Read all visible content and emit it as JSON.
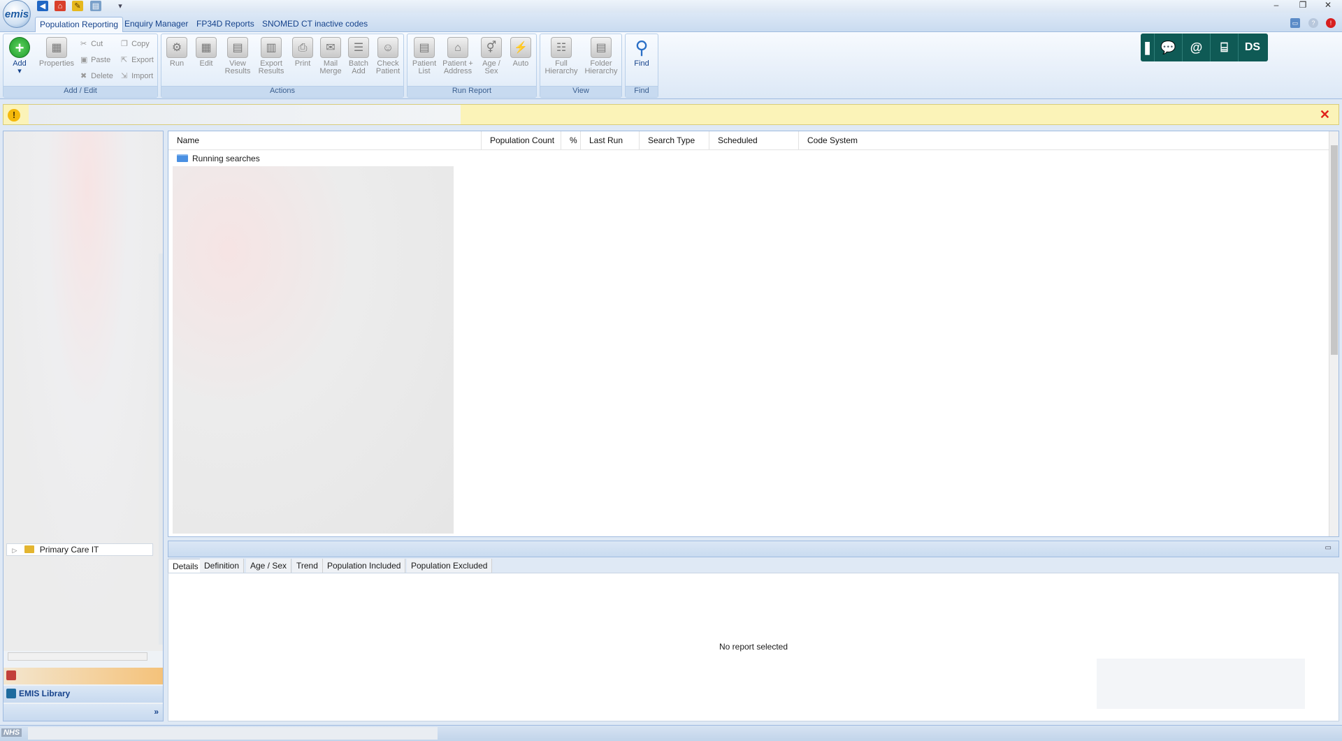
{
  "app": {
    "logo_text": "emis"
  },
  "window": {
    "minimize": "–",
    "restore": "❐",
    "close": "✕"
  },
  "ribbon_tabs": [
    {
      "label": "Population Reporting",
      "active": true
    },
    {
      "label": "Enquiry Manager",
      "active": false
    },
    {
      "label": "FP34D Reports",
      "active": false
    },
    {
      "label": "SNOMED CT inactive codes",
      "active": false
    }
  ],
  "ribbon": {
    "groups": {
      "add_edit": "Add / Edit",
      "actions": "Actions",
      "run_report": "Run Report",
      "view": "View",
      "find": "Find"
    },
    "add": {
      "label": "Add",
      "arrow": "▾"
    },
    "properties": "Properties",
    "cut": "Cut",
    "paste": "Paste",
    "delete": "Delete",
    "copy": "Copy",
    "export": "Export",
    "import": "Import",
    "run": "Run",
    "edit": "Edit",
    "view_results": "View Results",
    "export_results": "Export Results",
    "print": "Print",
    "mail_merge": "Mail Merge",
    "batch_add": "Batch Add",
    "check_patient": "Check Patient",
    "patient_list": "Patient List",
    "patient_address": "Patient + Address",
    "age_sex": "Age / Sex",
    "auto": "Auto",
    "full_hierarchy": "Full Hierarchy",
    "folder_hierarchy": "Folder Hierarchy",
    "find": "Find"
  },
  "tools": {
    "user_initials": "DS"
  },
  "banner": {
    "close": "✕",
    "warn": "!"
  },
  "list": {
    "columns": [
      "Name",
      "Population Count",
      "%",
      "Last Run",
      "Search Type",
      "Scheduled",
      "Code System"
    ],
    "rows": [
      {
        "name": "Running searches"
      }
    ]
  },
  "nav": {
    "tree_item": "Primary Care IT",
    "emis_library": "EMIS Library"
  },
  "details": {
    "tabs": [
      "Details",
      "Definition",
      "Age / Sex",
      "Trend",
      "Population Included",
      "Population Excluded"
    ],
    "active_tab": "Details",
    "empty_message": "No report selected"
  },
  "status": {
    "nhs": "NHS"
  },
  "colors": {
    "accent": "#15428b",
    "banner": "#fbf3b8",
    "tool_bg": "#0f5a55",
    "close_red": "#e0221b"
  }
}
